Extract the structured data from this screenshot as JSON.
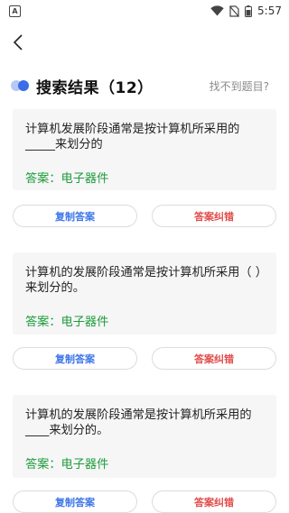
{
  "status_bar": {
    "app_badge": "A",
    "time": "5:57"
  },
  "header": {
    "title": "搜索结果（12）",
    "help_link": "找不到题目?"
  },
  "results": [
    {
      "question": "计算机发展阶段通常是按计算机所采用的_____来划分的",
      "answer": "答案：电子器件",
      "copy_label": "复制答案",
      "report_label": "答案纠错"
    },
    {
      "question": "计算机的发展阶段通常是按计算机所采用（ ）来划分的。",
      "answer": "答案：电子器件",
      "copy_label": "复制答案",
      "report_label": "答案纠错"
    },
    {
      "question": "计算机的发展阶段通常是按计算机所采用的____来划分的。",
      "answer": "答案：电子器件",
      "copy_label": "复制答案",
      "report_label": "答案纠错"
    }
  ],
  "colors": {
    "accent_blue": "#3d76e8",
    "answer_green": "#1e9b3e",
    "report_red": "#e24a4a"
  }
}
